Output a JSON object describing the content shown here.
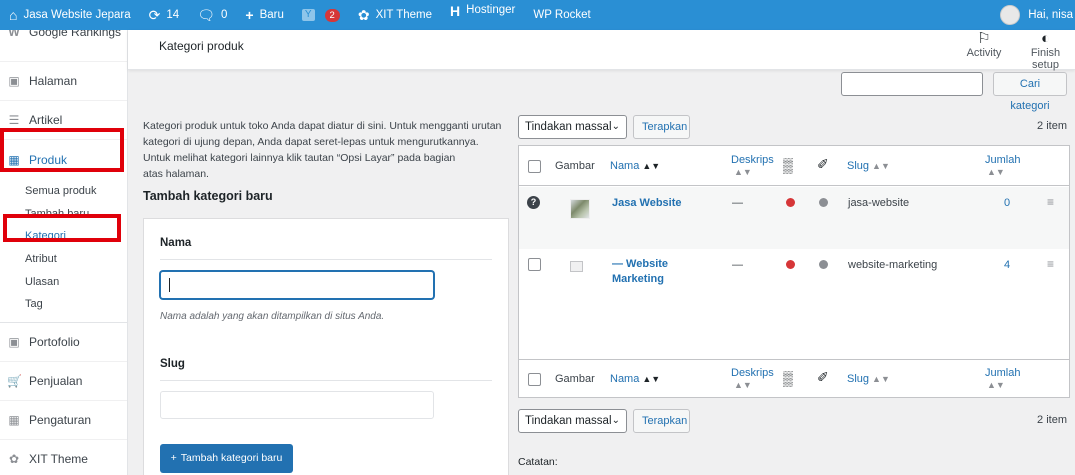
{
  "admin_bar": {
    "site_name": "Jasa Website Jepara",
    "updates_count": "14",
    "comments_count": "0",
    "new_label": "Baru",
    "yoast_badge": "2",
    "xit_theme": "XIT Theme",
    "hostinger": "Hostinger",
    "wp_rocket": "WP Rocket",
    "greeting": "Hai, nisa"
  },
  "sidebar": {
    "items_top": [
      {
        "label": "Google Rankings",
        "icon": "google-icon"
      },
      {
        "label": "Halaman",
        "icon": "pages-icon"
      },
      {
        "label": "Artikel",
        "icon": "posts-icon"
      }
    ],
    "active": {
      "label": "Produk",
      "icon": "product-icon"
    },
    "submenu": [
      "Semua produk",
      "Tambah baru",
      "Kategori",
      "Atribut",
      "Ulasan",
      "Tag"
    ],
    "items_bottom": [
      {
        "label": "Portofolio",
        "icon": "portfolio-icon"
      },
      {
        "label": "Penjualan",
        "icon": "cart-icon"
      },
      {
        "label": "Pengaturan",
        "icon": "settings-icon"
      },
      {
        "label": "XIT Theme",
        "icon": "xit-icon"
      }
    ]
  },
  "header": {
    "title": "Kategori produk",
    "activity": "Activity",
    "finish_setup": "Finish setup"
  },
  "search": {
    "button": "Cari kategori"
  },
  "intro": {
    "lines": [
      "Kategori produk untuk toko Anda dapat diatur di sini. Untuk mengganti urutan",
      "kategori di ujung depan, Anda dapat seret-lepas untuk mengurutkannya.",
      "Untuk melihat kategori lainnya klik tautan “Opsi Layar” pada bagian",
      "atas halaman."
    ]
  },
  "form": {
    "title": "Tambah kategori baru",
    "name_label": "Nama",
    "name_value": "",
    "name_help": "Nama adalah yang akan ditampilkan di situs Anda.",
    "slug_label": "Slug",
    "slug_value": "",
    "submit": "Tambah kategori baru"
  },
  "bulk": {
    "select_value": "Tindakan massal",
    "apply": "Terapkan",
    "count": "2 item"
  },
  "table": {
    "columns": {
      "image": "Gambar",
      "name": "Nama",
      "description": "Deskrips",
      "slug": "Slug",
      "count": "Jumlah"
    },
    "rows": [
      {
        "name": "Jasa Website",
        "description": "—",
        "slug": "jasa-website",
        "count": "0"
      },
      {
        "name_line1": "— Website",
        "name_line2": "Marketing",
        "description": "—",
        "slug": "website-marketing",
        "count": "4"
      }
    ]
  },
  "notes_label": "Catatan:",
  "colors": {
    "admin_bar": "#2a8fd4",
    "accent": "#2271b1",
    "highlight_box": "#e0000a",
    "status_red": "#d63638",
    "status_grey": "#8c8f94"
  }
}
